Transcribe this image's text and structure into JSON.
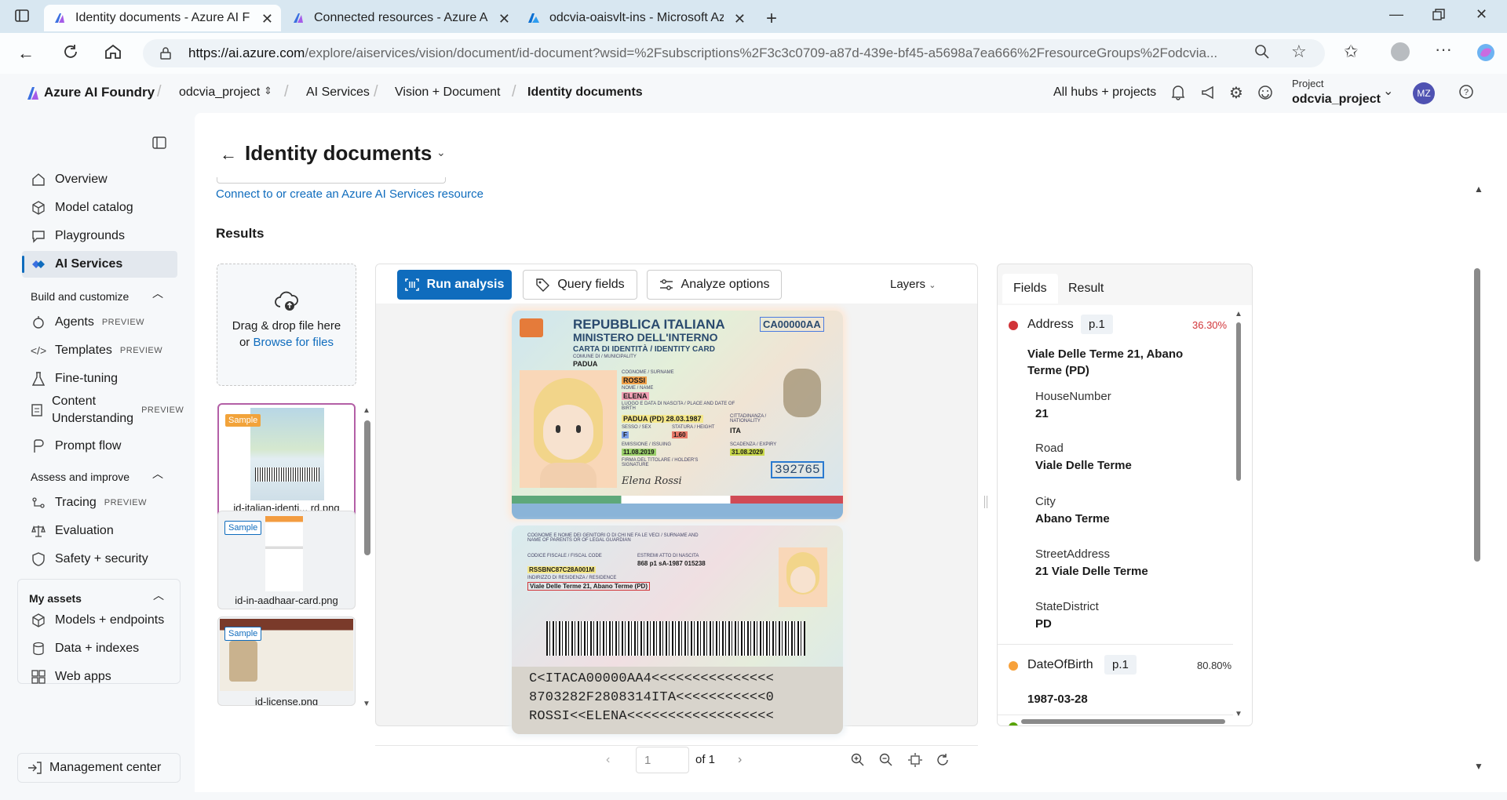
{
  "browser": {
    "tabs": [
      {
        "label": "Identity documents - Azure AI Fou",
        "active": true
      },
      {
        "label": "Connected resources - Azure AI F",
        "active": false
      },
      {
        "label": "odcvia-oaisvlt-ins - Microsoft Azu",
        "active": false
      }
    ],
    "url_host": "https://ai.azure.com",
    "url_path": "/explore/aiservices/vision/document/id-document?wsid=%2Fsubscriptions%2F3c3c0709-a87d-439e-bf45-a5698a7ea666%2FresourceGroups%2Fodcvia..."
  },
  "topnav": {
    "brand": "Azure AI Foundry",
    "project_switch": "odcvia_project",
    "crumbs": [
      "AI Services",
      "Vision + Document",
      "Identity documents"
    ],
    "all_hubs": "All hubs + projects",
    "project_label": "Project",
    "project_name": "odcvia_project",
    "avatar": "MZ"
  },
  "sidebar": {
    "items_top": [
      {
        "label": "Overview",
        "icon": "home-icon"
      },
      {
        "label": "Model catalog",
        "icon": "cube-icon"
      },
      {
        "label": "Playgrounds",
        "icon": "chat-icon"
      },
      {
        "label": "AI Services",
        "icon": "ai-services-icon",
        "selected": true
      }
    ],
    "build_heading": "Build and customize",
    "build_items": [
      {
        "label": "Agents",
        "badge": "PREVIEW"
      },
      {
        "label": "Templates",
        "badge": "PREVIEW"
      },
      {
        "label": "Fine-tuning",
        "badge": ""
      },
      {
        "label": "Content Understanding",
        "badge": "PREVIEW"
      },
      {
        "label": "Prompt flow",
        "badge": ""
      }
    ],
    "assess_heading": "Assess and improve",
    "assess_items": [
      {
        "label": "Tracing",
        "badge": "PREVIEW"
      },
      {
        "label": "Evaluation",
        "badge": ""
      },
      {
        "label": "Safety + security",
        "badge": ""
      }
    ],
    "assets_heading": "My assets",
    "assets_items": [
      {
        "label": "Models + endpoints"
      },
      {
        "label": "Data + indexes"
      },
      {
        "label": "Web apps"
      }
    ],
    "management": "Management center"
  },
  "main": {
    "title": "Identity documents",
    "connect_link": "Connect to or create an Azure AI Services resource",
    "results_heading": "Results",
    "upload": {
      "text1": "Drag & drop file here",
      "text2_prefix": "or ",
      "browse": "Browse for files"
    },
    "samples": [
      {
        "badge": "Sample",
        "name": "id-italian-identi... rd.png",
        "selected": true
      },
      {
        "badge": "Sample",
        "name": "id-in-aadhaar-card.png",
        "selected": false
      },
      {
        "badge": "Sample",
        "name": "id-license.png",
        "selected": false
      }
    ],
    "toolbar": {
      "run": "Run analysis",
      "query": "Query fields",
      "analyze": "Analyze options",
      "layers": "Layers"
    },
    "pager": {
      "page": "1",
      "of": "of 1"
    },
    "card_front": {
      "country": "REPUBBLICA ITALIANA",
      "ministry": "MINISTERO DELL'INTERNO",
      "doc_type": "CARTA DI IDENTITÀ / IDENTITY CARD",
      "doc_no": "CA00000AA",
      "municipality_label": "COMUNE DI / MUNICIPALITY",
      "municipality": "PADUA",
      "surname_label": "COGNOME / SURNAME",
      "surname": "ROSSI",
      "name_label": "NOME / NAME",
      "name": "ELENA",
      "birth_label": "LUOGO E DATA DI NASCITA / PLACE AND DATE OF BIRTH",
      "birth": "PADUA (PD) 28.03.1987",
      "sex_label": "SESSO / SEX",
      "sex": "F",
      "height_label": "STATURA / HEIGHT",
      "height": "1.60",
      "nationality_label": "CITTADINANZA / NATIONALITY",
      "nationality": "ITA",
      "issue_label": "EMISSIONE / ISSUING",
      "issue": "11.08.2019",
      "expiry_label": "SCADENZA / EXPIRY",
      "expiry": "31.08.2029",
      "signature_label": "FIRMA DEL TITOLARE / HOLDER'S SIGNATURE",
      "signature": "Elena Rossi",
      "can": "392765"
    },
    "card_back": {
      "parents_label": "COGNOME E NOME DEI GENITORI O DI CHI NE FA LE VECI / SURNAME AND NAME OF PARENTS OR OF LEGAL GUARDIAN",
      "fiscal_label": "CODICE FISCALE / FISCAL CODE",
      "fiscal": "RSSBNC87C28A001M",
      "act_label": "ESTREMI ATTO DI NASCITA",
      "act": "868 p1 sA-1987 015238",
      "residence_label": "INDIRIZZO DI RESIDENZA / RESIDENCE",
      "residence": "Viale Delle Terme 21, Abano Terme (PD)",
      "mrz1": "C<ITACA00000AA4<<<<<<<<<<<<<<<",
      "mrz2": "8703282F2808314ITA<<<<<<<<<<<0",
      "mrz3": "ROSSI<<ELENA<<<<<<<<<<<<<<<<<<"
    },
    "fields_panel": {
      "tabs": [
        "Fields",
        "Result"
      ],
      "address": {
        "name": "Address",
        "page": "p.1",
        "confidence": "36.30%",
        "color": "#d13438",
        "value": "Viale Delle Terme 21, Abano Terme (PD)"
      },
      "subfields": [
        {
          "label": "HouseNumber",
          "value": "21"
        },
        {
          "label": "Road",
          "value": "Viale Delle Terme"
        },
        {
          "label": "City",
          "value": "Abano Terme"
        },
        {
          "label": "StreetAddress",
          "value": "21 Viale Delle Terme"
        },
        {
          "label": "StateDistrict",
          "value": "PD"
        }
      ],
      "dob": {
        "name": "DateOfBirth",
        "page": "p.1",
        "confidence": "80.80%",
        "color": "#f7a13b",
        "value": "1987-03-28"
      },
      "next_color": "#57a300"
    }
  }
}
